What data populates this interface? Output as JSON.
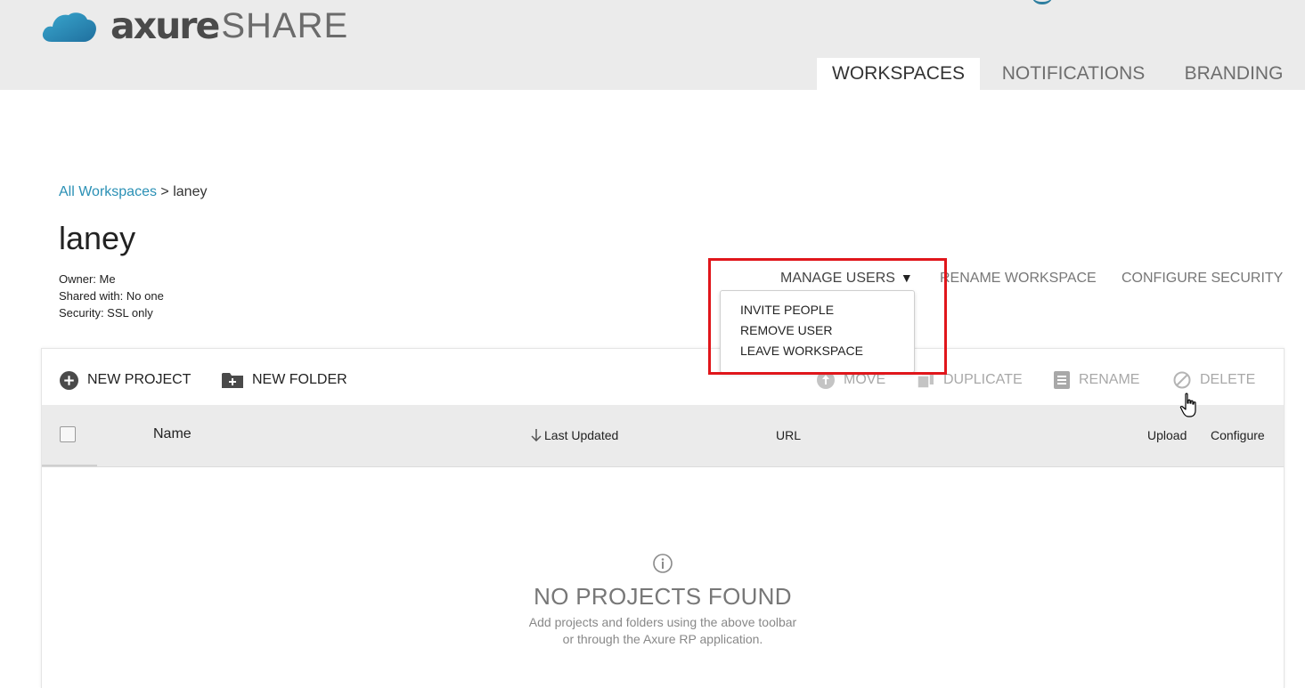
{
  "app": {
    "logo_main": "axure",
    "logo_sub": "SHARE"
  },
  "tabs": [
    {
      "label": "WORKSPACES",
      "active": true
    },
    {
      "label": "NOTIFICATIONS",
      "active": false
    },
    {
      "label": "BRANDING",
      "active": false
    }
  ],
  "breadcrumb": {
    "root": "All Workspaces",
    "separator": ">",
    "current": "laney"
  },
  "workspace": {
    "title": "laney",
    "owner": "Owner: Me",
    "shared": "Shared with: No one",
    "security": "Security: SSL only"
  },
  "workspace_actions": {
    "manage_users": "MANAGE USERS",
    "rename": "RENAME WORKSPACE",
    "configure": "CONFIGURE SECURITY"
  },
  "manage_users_menu": {
    "items": [
      "INVITE PEOPLE",
      "REMOVE USER",
      "LEAVE WORKSPACE"
    ]
  },
  "toolbar": {
    "new_project": "NEW PROJECT",
    "new_folder": "NEW FOLDER",
    "move": "MOVE",
    "duplicate": "DUPLICATE",
    "rename": "RENAME",
    "delete": "DELETE"
  },
  "table": {
    "columns": {
      "name": "Name",
      "last_updated": "Last Updated",
      "url": "URL",
      "upload": "Upload",
      "configure": "Configure"
    },
    "sort_icon": "arrow-down-icon"
  },
  "empty_state": {
    "icon": "info-icon",
    "title": "NO PROJECTS FOUND",
    "line1": "Add projects and folders using the above toolbar",
    "line2": "or through the Axure RP application."
  },
  "colors": {
    "accent": "#2a90b5",
    "highlight": "#e0161b",
    "header_bg": "#ebebeb"
  }
}
